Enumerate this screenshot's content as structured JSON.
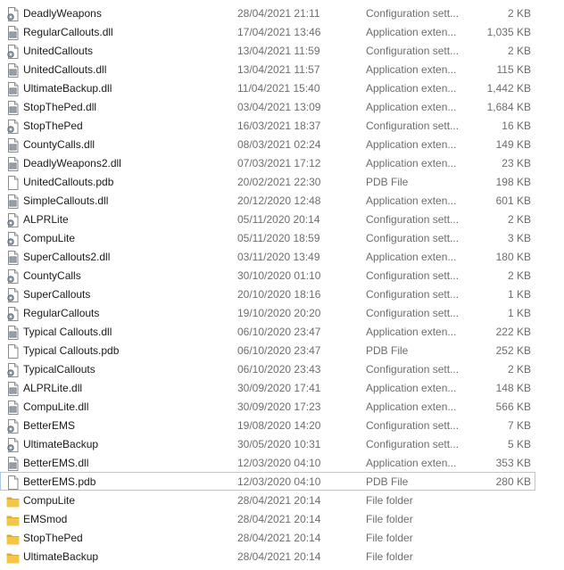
{
  "colors": {
    "selection_border": "#a9cbe8",
    "folder": "#f3c64a",
    "secondary_text": "#6d6d6d"
  },
  "files": [
    {
      "name": "DeadlyWeapons",
      "date": "28/04/2021 21:11",
      "type": "Configuration sett...",
      "size": "2 KB",
      "icon": "settings-file-icon"
    },
    {
      "name": "RegularCallouts.dll",
      "date": "17/04/2021 13:46",
      "type": "Application exten...",
      "size": "1,035 KB",
      "icon": "dll-file-icon"
    },
    {
      "name": "UnitedCallouts",
      "date": "13/04/2021 11:59",
      "type": "Configuration sett...",
      "size": "2 KB",
      "icon": "settings-file-icon"
    },
    {
      "name": "UnitedCallouts.dll",
      "date": "13/04/2021 11:57",
      "type": "Application exten...",
      "size": "115 KB",
      "icon": "dll-file-icon"
    },
    {
      "name": "UltimateBackup.dll",
      "date": "11/04/2021 15:40",
      "type": "Application exten...",
      "size": "1,442 KB",
      "icon": "dll-file-icon"
    },
    {
      "name": "StopThePed.dll",
      "date": "03/04/2021 13:09",
      "type": "Application exten...",
      "size": "1,684 KB",
      "icon": "dll-file-icon"
    },
    {
      "name": "StopThePed",
      "date": "16/03/2021 18:37",
      "type": "Configuration sett...",
      "size": "16 KB",
      "icon": "settings-file-icon"
    },
    {
      "name": "CountyCalls.dll",
      "date": "08/03/2021 02:24",
      "type": "Application exten...",
      "size": "149 KB",
      "icon": "dll-file-icon"
    },
    {
      "name": "DeadlyWeapons2.dll",
      "date": "07/03/2021 17:12",
      "type": "Application exten...",
      "size": "23 KB",
      "icon": "dll-file-icon"
    },
    {
      "name": "UnitedCallouts.pdb",
      "date": "20/02/2021 22:30",
      "type": "PDB File",
      "size": "198 KB",
      "icon": "blank-file-icon"
    },
    {
      "name": "SimpleCallouts.dll",
      "date": "20/12/2020 12:48",
      "type": "Application exten...",
      "size": "601 KB",
      "icon": "dll-file-icon"
    },
    {
      "name": "ALPRLite",
      "date": "05/11/2020 20:14",
      "type": "Configuration sett...",
      "size": "2 KB",
      "icon": "settings-file-icon"
    },
    {
      "name": "CompuLite",
      "date": "05/11/2020 18:59",
      "type": "Configuration sett...",
      "size": "3 KB",
      "icon": "settings-file-icon"
    },
    {
      "name": "SuperCallouts2.dll",
      "date": "03/11/2020 13:49",
      "type": "Application exten...",
      "size": "180 KB",
      "icon": "dll-file-icon"
    },
    {
      "name": "CountyCalls",
      "date": "30/10/2020 01:10",
      "type": "Configuration sett...",
      "size": "2 KB",
      "icon": "settings-file-icon"
    },
    {
      "name": "SuperCallouts",
      "date": "20/10/2020 18:16",
      "type": "Configuration sett...",
      "size": "1 KB",
      "icon": "settings-file-icon"
    },
    {
      "name": "RegularCallouts",
      "date": "19/10/2020 20:20",
      "type": "Configuration sett...",
      "size": "1 KB",
      "icon": "settings-file-icon"
    },
    {
      "name": "Typical Callouts.dll",
      "date": "06/10/2020 23:47",
      "type": "Application exten...",
      "size": "222 KB",
      "icon": "dll-file-icon"
    },
    {
      "name": "Typical Callouts.pdb",
      "date": "06/10/2020 23:47",
      "type": "PDB File",
      "size": "252 KB",
      "icon": "blank-file-icon"
    },
    {
      "name": "TypicalCallouts",
      "date": "06/10/2020 23:43",
      "type": "Configuration sett...",
      "size": "2 KB",
      "icon": "settings-file-icon"
    },
    {
      "name": "ALPRLite.dll",
      "date": "30/09/2020 17:41",
      "type": "Application exten...",
      "size": "148 KB",
      "icon": "dll-file-icon"
    },
    {
      "name": "CompuLite.dll",
      "date": "30/09/2020 17:23",
      "type": "Application exten...",
      "size": "566 KB",
      "icon": "dll-file-icon"
    },
    {
      "name": "BetterEMS",
      "date": "19/08/2020 14:20",
      "type": "Configuration sett...",
      "size": "7 KB",
      "icon": "settings-file-icon"
    },
    {
      "name": "UltimateBackup",
      "date": "30/05/2020 10:31",
      "type": "Configuration sett...",
      "size": "5 KB",
      "icon": "settings-file-icon"
    },
    {
      "name": "BetterEMS.dll",
      "date": "12/03/2020 04:10",
      "type": "Application exten...",
      "size": "353 KB",
      "icon": "dll-file-icon"
    },
    {
      "name": "BetterEMS.pdb",
      "date": "12/03/2020 04:10",
      "type": "PDB File",
      "size": "280 KB",
      "icon": "blank-file-icon",
      "selected": true
    },
    {
      "name": "CompuLite",
      "date": "28/04/2021 20:14",
      "type": "File folder",
      "size": "",
      "icon": "folder-icon"
    },
    {
      "name": "EMSmod",
      "date": "28/04/2021 20:14",
      "type": "File folder",
      "size": "",
      "icon": "folder-icon"
    },
    {
      "name": "StopThePed",
      "date": "28/04/2021 20:14",
      "type": "File folder",
      "size": "",
      "icon": "folder-icon"
    },
    {
      "name": "UltimateBackup",
      "date": "28/04/2021 20:14",
      "type": "File folder",
      "size": "",
      "icon": "folder-icon"
    }
  ]
}
